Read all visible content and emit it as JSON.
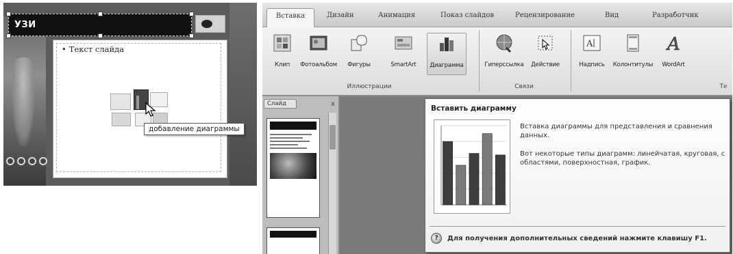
{
  "left_panel": {
    "title_placeholder_text": "УЗИ",
    "bullet_text": "Текст слайда",
    "tooltip": "добавление диаграммы"
  },
  "ribbon": {
    "tabs": [
      "Вставка",
      "Дизайн",
      "Анимация",
      "Показ слайдов",
      "Рецензирование",
      "Вид",
      "Разработчик"
    ],
    "active_tab": "Вставка",
    "buttons": [
      {
        "label": "Клип",
        "icon": "clipart-icon"
      },
      {
        "label": "Фотоальбом",
        "icon": "photo-album-icon"
      },
      {
        "label": "Фигуры",
        "icon": "shapes-icon"
      },
      {
        "label": "SmartArt",
        "icon": "smartart-icon"
      },
      {
        "label": "Диаграмма",
        "icon": "chart-icon"
      },
      {
        "label": "Гиперссылка",
        "icon": "hyperlink-globe-icon"
      },
      {
        "label": "Действие",
        "icon": "action-icon"
      },
      {
        "label": "Надпись",
        "icon": "textbox-icon"
      },
      {
        "label": "Колонтитулы",
        "icon": "header-footer-icon"
      },
      {
        "label": "WordArt",
        "icon": "wordart-icon"
      }
    ],
    "groups": [
      "Иллюстрации",
      "Связи",
      "Те"
    ]
  },
  "thumbnails_pane": {
    "tab_label": "Слайд",
    "close_glyph": "x"
  },
  "insert_chart_tooltip": {
    "title": "Вставить диаграмму",
    "description_1": "Вставка диаграммы для представления и сравнения данных.",
    "description_2": "Вот некоторые типы диаграмм: линейчатая, круговая, с областями, поверхностная, график.",
    "help_text": "Для получения дополнительных сведений нажмите клавишу F1."
  },
  "chart_data": {
    "type": "bar",
    "values": [
      80,
      50,
      65,
      90,
      63
    ],
    "ylim": [
      0,
      100
    ],
    "grid": true
  },
  "colors": {
    "tooltip_bg": "#f4f4f4",
    "bar_fill": "#3e3e3e",
    "ribbon_bg": "#e6e6e6"
  }
}
